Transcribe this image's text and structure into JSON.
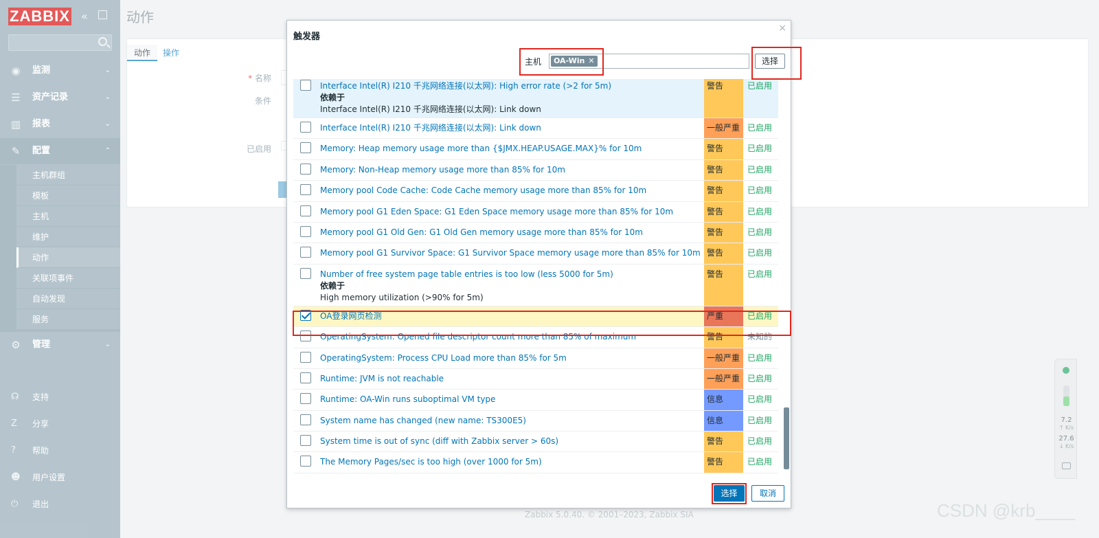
{
  "app": {
    "logo": "ZABBIX",
    "collapse_icon": "double-chevron-left",
    "kiosk_icon": "kiosk-mode"
  },
  "sidebar": {
    "search_placeholder": "",
    "menu": [
      {
        "label": "监测",
        "icon": "eye-icon"
      },
      {
        "label": "资产记录",
        "icon": "list-icon"
      },
      {
        "label": "报表",
        "icon": "bar-chart-icon"
      },
      {
        "label": "配置",
        "icon": "wrench-icon"
      },
      {
        "label": "管理",
        "icon": "gear-icon"
      }
    ],
    "config_sub": [
      {
        "label": "主机群组"
      },
      {
        "label": "模板"
      },
      {
        "label": "主机"
      },
      {
        "label": "维护"
      },
      {
        "label": "动作"
      },
      {
        "label": "关联项事件"
      },
      {
        "label": "自动发现"
      },
      {
        "label": "服务"
      }
    ],
    "footer": [
      {
        "label": "支持",
        "icon": "headset-icon"
      },
      {
        "label": "分享",
        "icon": "share-icon"
      },
      {
        "label": "帮助",
        "icon": "help-icon"
      },
      {
        "label": "用户设置",
        "icon": "user-icon"
      },
      {
        "label": "退出",
        "icon": "power-icon"
      }
    ]
  },
  "page": {
    "title": "动作",
    "tabs": [
      "动作",
      "操作"
    ],
    "labels": {
      "name": "名称",
      "conditions": "条件",
      "enabled": "已启用"
    },
    "required_mark": "*"
  },
  "dialog": {
    "title": "触发器",
    "host_label": "主机",
    "host_chip": "OA-Win",
    "host_select_button": "选择",
    "select_button": "选择",
    "cancel_button": "取消",
    "triggers": [
      {
        "name": "Interface Intel(R) I210 千兆网络连接(以太网): High error rate (>2 for 5m)",
        "depends_label": "依赖于",
        "depends": "Interface Intel(R) I210 千兆网络连接(以太网): Link down",
        "severity": "警告",
        "sev_class": "warn",
        "status": "已启用",
        "checked": false,
        "highlight": true
      },
      {
        "name": "Interface Intel(R) I210 千兆网络连接(以太网): Link down",
        "severity": "一般严重",
        "sev_class": "avg",
        "status": "已启用",
        "checked": false
      },
      {
        "name": "Memory: Heap memory usage more than {$JMX.HEAP.USAGE.MAX}% for 10m",
        "severity": "警告",
        "sev_class": "warn",
        "status": "已启用",
        "checked": false
      },
      {
        "name": "Memory: Non-Heap memory usage more than 85% for 10m",
        "severity": "警告",
        "sev_class": "warn",
        "status": "已启用",
        "checked": false
      },
      {
        "name": "Memory pool Code Cache: Code Cache memory usage more than 85% for 10m",
        "severity": "警告",
        "sev_class": "warn",
        "status": "已启用",
        "checked": false
      },
      {
        "name": "Memory pool G1 Eden Space: G1 Eden Space memory usage more than 85% for 10m",
        "severity": "警告",
        "sev_class": "warn",
        "status": "已启用",
        "checked": false
      },
      {
        "name": "Memory pool G1 Old Gen: G1 Old Gen memory usage more than 85% for 10m",
        "severity": "警告",
        "sev_class": "warn",
        "status": "已启用",
        "checked": false
      },
      {
        "name": "Memory pool G1 Survivor Space: G1 Survivor Space memory usage more than 85% for 10m",
        "severity": "警告",
        "sev_class": "warn",
        "status": "已启用",
        "checked": false
      },
      {
        "name": "Number of free system page table entries is too low (less 5000 for 5m)",
        "depends_label": "依赖于",
        "depends": "High memory utilization (>90% for 5m)",
        "severity": "警告",
        "sev_class": "warn",
        "status": "已启用",
        "checked": false
      },
      {
        "name": "OA登录网页检测",
        "severity": "严重",
        "sev_class": "high",
        "status": "已启用",
        "checked": true
      },
      {
        "name": "OperatingSystem: Opened file descriptor count more than 85% of maximum",
        "severity": "警告",
        "sev_class": "warn",
        "status": "未知的",
        "checked": false,
        "unknown": true
      },
      {
        "name": "OperatingSystem: Process CPU Load more than 85% for 5m",
        "severity": "一般严重",
        "sev_class": "avg",
        "status": "已启用",
        "checked": false
      },
      {
        "name": "Runtime: JVM is not reachable",
        "severity": "一般严重",
        "sev_class": "avg",
        "status": "已启用",
        "checked": false
      },
      {
        "name": "Runtime: OA-Win runs suboptimal VM type",
        "severity": "信息",
        "sev_class": "info",
        "status": "已启用",
        "checked": false
      },
      {
        "name": "System name has changed (new name: TS300E5)",
        "severity": "信息",
        "sev_class": "info",
        "status": "已启用",
        "checked": false
      },
      {
        "name": "System time is out of sync (diff with Zabbix server > 60s)",
        "severity": "警告",
        "sev_class": "warn",
        "status": "已启用",
        "checked": false
      },
      {
        "name": "The Memory Pages/sec is too high (over 1000 for 5m)",
        "severity": "警告",
        "sev_class": "warn",
        "status": "已启用",
        "checked": false
      }
    ]
  },
  "footer": {
    "copyright": "Zabbix 5.0.40. © 2001–2023, Zabbix SIA"
  },
  "watermark": "CSDN @krb____",
  "net_widget": {
    "up": "7.2",
    "up_unit": "↑ K/s",
    "down": "27.6",
    "down_unit": "↓ K/s"
  },
  "colors": {
    "accent": "#0275b8",
    "sidebar": "#8fa6b3",
    "warning": "#ffc859",
    "average": "#ffa059",
    "high": "#e97659",
    "info": "#7499ff",
    "enabled": "#1fa463",
    "annotation": "#e0271e"
  }
}
